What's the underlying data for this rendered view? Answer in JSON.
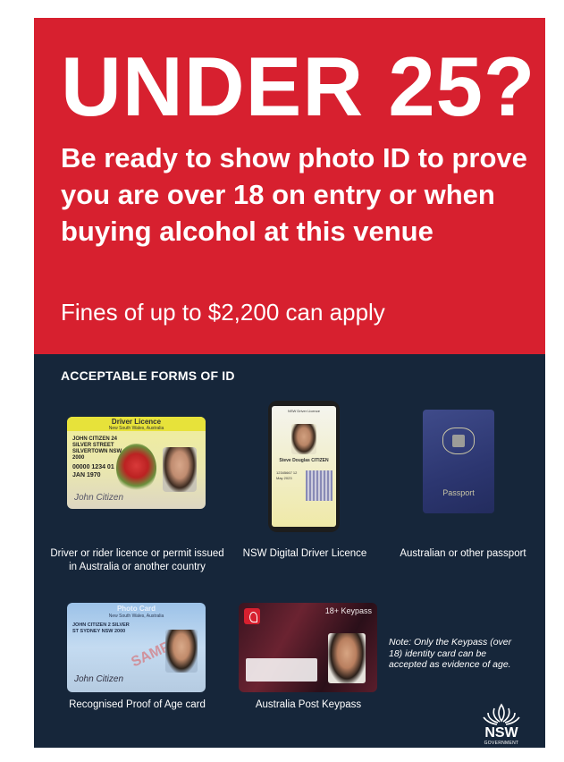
{
  "headline": "UNDER 25?",
  "subheadline": "Be ready to show photo ID to prove you are over 18 on entry or when buying alcohol at this venue",
  "fines": "Fines of up to $2,200 can apply",
  "section_title": "ACCEPTABLE FORMS OF ID",
  "ids": {
    "driver_licence": {
      "caption": "Driver or rider licence or permit issued in Australia or another country",
      "card_title": "Driver Licence",
      "card_subtitle": "New South Wales, Australia",
      "card_name": "JOHN CITIZEN 24 SILVER STREET SILVERTOWN NSW 2000",
      "card_number": "00000 1234 01 JAN 1970",
      "card_signature": "John Citizen"
    },
    "digital_licence": {
      "caption": "NSW Digital Driver Licence",
      "screen_title": "NSW Driver Licence",
      "screen_name": "Steve Douglas CITIZEN",
      "screen_details": "12345667 12 May 2023"
    },
    "passport": {
      "caption": "Australian or other passport",
      "cover_text": "Passport"
    },
    "photo_card": {
      "caption": "Recognised Proof of Age card",
      "card_title": "Photo Card",
      "card_subtitle": "New South Wales, Australia",
      "card_name": "JOHN CITIZEN 2 SILVER ST SYDNEY NSW 2000",
      "card_watermark": "SAMPLE",
      "card_signature": "John Citizen"
    },
    "keypass": {
      "caption": "Australia Post Keypass",
      "card_label": "18+ Keypass"
    }
  },
  "note": "Note: Only the Keypass (over 18) identity card can be accepted as evidence of age.",
  "logo": {
    "text": "NSW",
    "subtext": "GOVERNMENT"
  },
  "colors": {
    "red": "#d7202f",
    "navy": "#16263a",
    "white": "#ffffff"
  }
}
